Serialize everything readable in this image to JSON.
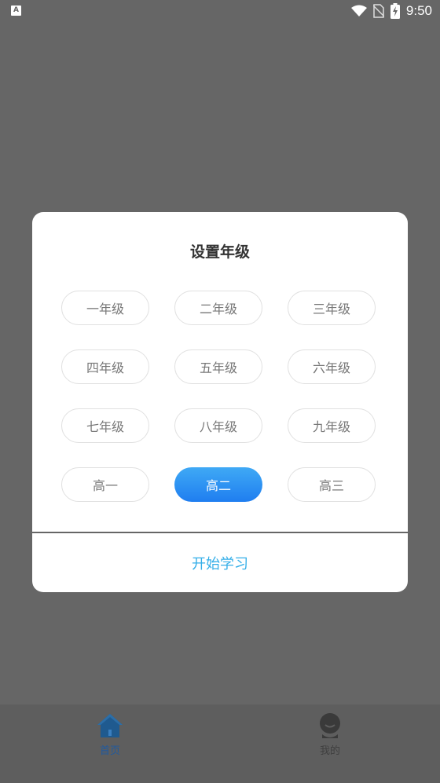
{
  "status_bar": {
    "left_icon_letter": "A",
    "time": "9:50",
    "icons": [
      "wifi-icon",
      "no-sim-icon",
      "battery-charging-icon"
    ]
  },
  "dialog": {
    "title": "设置年级",
    "grades": [
      {
        "label": "一年级",
        "selected": false
      },
      {
        "label": "二年级",
        "selected": false
      },
      {
        "label": "三年级",
        "selected": false
      },
      {
        "label": "四年级",
        "selected": false
      },
      {
        "label": "五年级",
        "selected": false
      },
      {
        "label": "六年级",
        "selected": false
      },
      {
        "label": "七年级",
        "selected": false
      },
      {
        "label": "八年级",
        "selected": false
      },
      {
        "label": "九年级",
        "selected": false
      },
      {
        "label": "高一",
        "selected": false
      },
      {
        "label": "高二",
        "selected": true
      },
      {
        "label": "高三",
        "selected": false
      }
    ],
    "start_button": "开始学习"
  },
  "bottom_nav": {
    "items": [
      {
        "label": "首页",
        "icon": "home-icon",
        "active": true
      },
      {
        "label": "我的",
        "icon": "profile-icon",
        "active": false
      }
    ]
  },
  "colors": {
    "selected_gradient_top": "#3fa9f5",
    "selected_gradient_bottom": "#1f7ef0",
    "start_button_text": "#33aee8",
    "overlay": "#666666"
  }
}
